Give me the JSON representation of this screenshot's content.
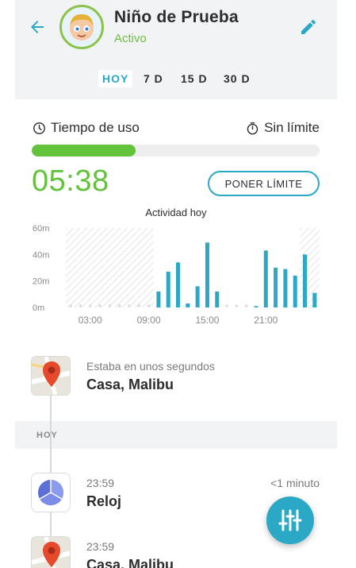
{
  "header": {
    "child_name": "Niño de Prueba",
    "child_status": "Activo",
    "icons": {
      "back": "arrow-left-icon",
      "edit": "pencil-icon",
      "avatar": "child-avatar"
    }
  },
  "tabs": [
    {
      "label": "HOY",
      "active": true
    },
    {
      "label": "7 D",
      "active": false
    },
    {
      "label": "15 D",
      "active": false
    },
    {
      "label": "30 D",
      "active": false
    }
  ],
  "usage": {
    "title": "Tiempo de uso",
    "limit_label": "Sin límite",
    "progress_percent": 36,
    "time_used": "05:38",
    "limit_button": "PONER LÍMITE"
  },
  "chart_data": {
    "type": "bar",
    "title": "Actividad hoy",
    "y_ticks": [
      "60m",
      "40m",
      "20m",
      "0m"
    ],
    "ylim": [
      0,
      60
    ],
    "x_tick_labels": [
      "03:00",
      "09:00",
      "15:00",
      "21:00"
    ],
    "unit": "minutes",
    "values": [
      0,
      0,
      0,
      0,
      0,
      0,
      0,
      0,
      0,
      12,
      27,
      34,
      3,
      16,
      49,
      12,
      0,
      0,
      0,
      1,
      43,
      30,
      29,
      24,
      40,
      11
    ]
  },
  "location": {
    "subtitle": "Estaba en unos segundos",
    "place": "Casa, Malibu"
  },
  "section_label": "HOY",
  "feed": [
    {
      "time": "23:59",
      "title": "Reloj",
      "duration": "<1 minuto",
      "icon": "clock-app-icon"
    },
    {
      "time": "23:59",
      "title": "Casa, Malibu",
      "icon": "map-pin-icon"
    }
  ],
  "colors": {
    "accent": "#2aa8c6",
    "active_green": "#62c23a",
    "hatch": "#e6e6e6"
  }
}
